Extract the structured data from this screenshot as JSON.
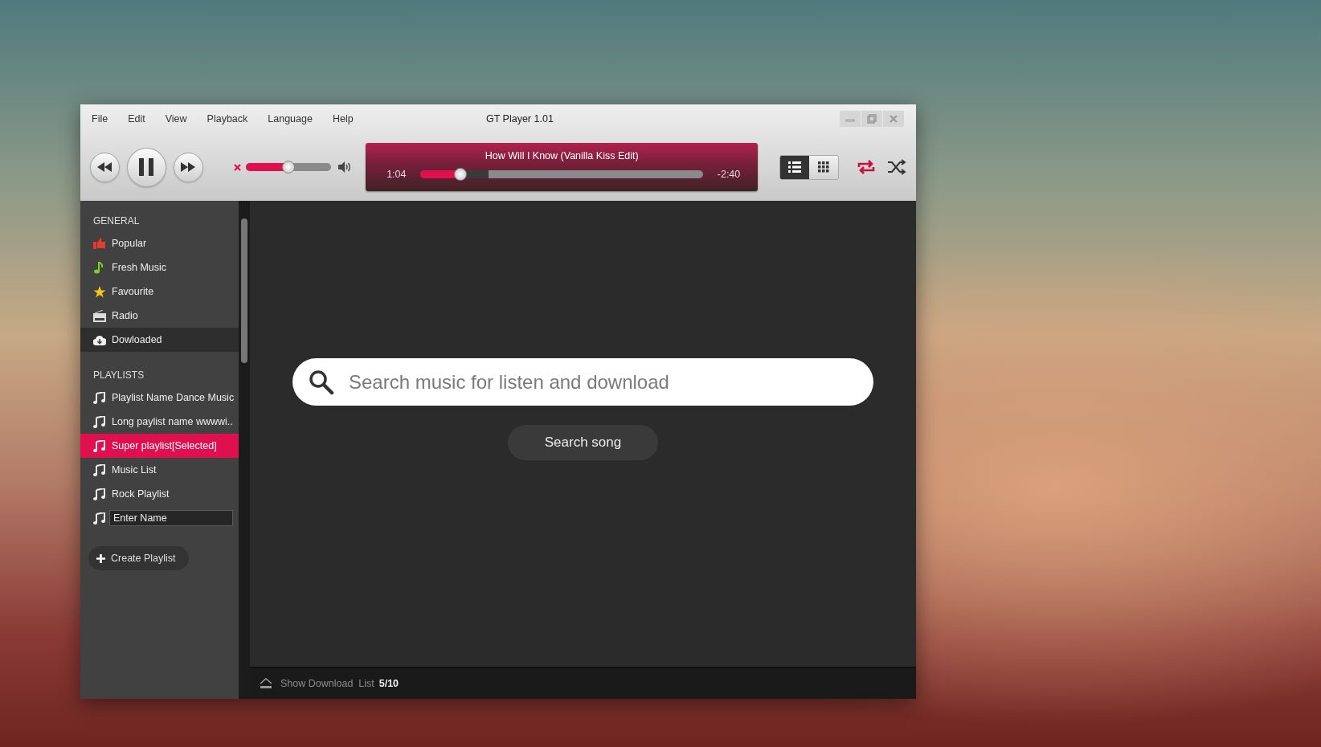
{
  "window": {
    "title": "GT Player 1.01"
  },
  "menu": [
    "File",
    "Edit",
    "View",
    "Playback",
    "Language",
    "Help"
  ],
  "player": {
    "playing": true,
    "muted": true,
    "volume": {
      "level": 0.5
    },
    "now_playing": {
      "title": "How Will I Know (Vanilla Kiss Edit)",
      "elapsed": "1:04",
      "remaining": "-2:40",
      "progress": {
        "level": 0.14
      },
      "buffer": {
        "level": 0.24
      }
    },
    "views": [
      {
        "kind": "list",
        "selected": true
      },
      {
        "kind": "grid",
        "selected": false
      }
    ],
    "repeat": {
      "on": true
    },
    "shuffle": {
      "on": false
    }
  },
  "sidebar": {
    "general": {
      "heading": "GENERAL",
      "items": [
        {
          "label": "Popular",
          "selected": false
        },
        {
          "label": "Fresh Music",
          "selected": false
        },
        {
          "label": "Favourite",
          "selected": false
        },
        {
          "label": "Radio",
          "selected": false
        },
        {
          "label": "Dowloaded",
          "selected": true
        }
      ]
    },
    "playlists": {
      "heading": "PLAYLISTS",
      "items": [
        {
          "kind": "item",
          "label": "Playlist Name Dance Music",
          "selected": false
        },
        {
          "kind": "item",
          "label": "Long paylist name wwwwi..",
          "selected": false
        },
        {
          "kind": "item",
          "label": "Super playlist[Selected]",
          "selected": true
        },
        {
          "kind": "item",
          "label": "Music List",
          "selected": false
        },
        {
          "kind": "item",
          "label": "Rock Playlist",
          "selected": false
        },
        {
          "kind": "input",
          "value": "Enter Name",
          "selected": false
        }
      ]
    },
    "create_button": "Create Playlist"
  },
  "search": {
    "placeholder": "Search music for listen and download",
    "button": "Search song"
  },
  "status_bar": {
    "label": "Show Download  List",
    "count": "5/10"
  }
}
